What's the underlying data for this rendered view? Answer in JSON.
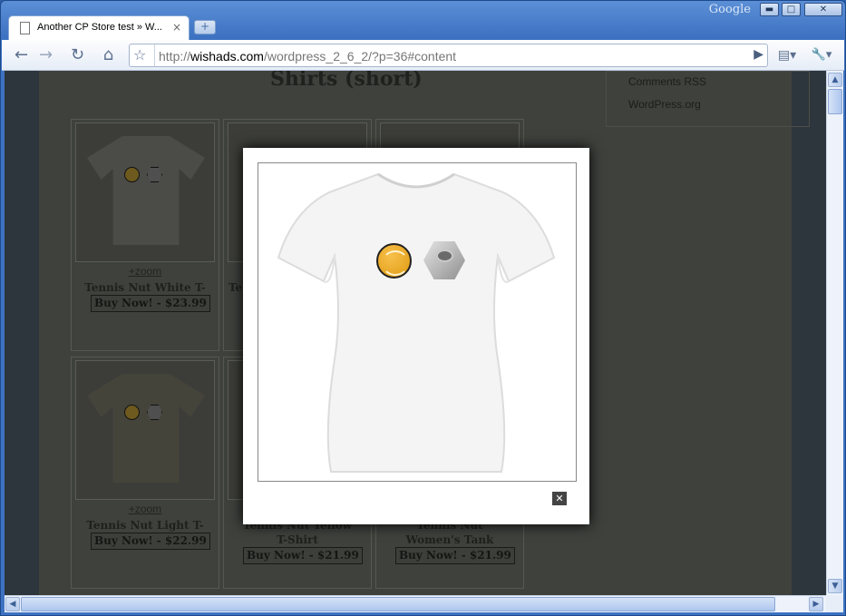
{
  "browser": {
    "brand_label": "Google",
    "tab": {
      "title": "Another CP Store test » W...",
      "close": "×"
    },
    "new_tab": "+",
    "window_buttons": {
      "minimize": "▬",
      "maximize": "□",
      "close": "✕"
    },
    "toolbar": {
      "back": "←",
      "forward": "→",
      "reload": "↻",
      "home": "⌂",
      "star": "☆",
      "go": "▶",
      "page_menu": "▤▾",
      "tools_menu": "🔧▾"
    },
    "url": {
      "scheme": "http://",
      "domain": "wishads.com",
      "path": "/wordpress_2_6_2/?p=36#content"
    }
  },
  "page": {
    "title": "Shirts (short)",
    "sidebar_links": [
      "Comments RSS",
      "WordPress.org"
    ],
    "products": [
      {
        "zoom": "+zoom",
        "name": "Tennis Nut White T-Shirt",
        "buy": "Buy Now! - $23.99"
      },
      {
        "zoom": "",
        "name": "Te",
        "buy": ""
      },
      {
        "zoom": "",
        "name": "",
        "buy": ""
      },
      {
        "zoom": "+zoom",
        "name": "Tennis Nut Light T-Shirt",
        "buy": "Buy Now! - $22.99"
      },
      {
        "zoom": "",
        "name": "Tennis Nut Yellow T-Shirt",
        "buy": "Buy Now! - $21.99"
      },
      {
        "zoom": "",
        "name": "Tennis Nut Women's Tank Top",
        "buy": "Buy Now! - $21.99"
      }
    ]
  },
  "lightbox": {
    "close": "✕"
  },
  "scrollbars": {
    "up": "▲",
    "down": "▼",
    "left": "◀",
    "right": "▶"
  }
}
